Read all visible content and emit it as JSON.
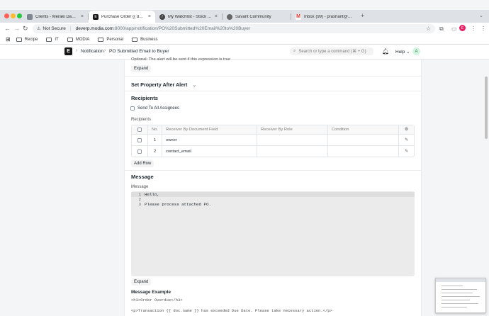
{
  "browser": {
    "tabs": [
      {
        "title": "Clients - Meraki Dashboard",
        "fav_color": "#7e8792",
        "active": false
      },
      {
        "title": "Purchase Order {{ doc.name }}",
        "fav_color": "#171717",
        "active": true
      },
      {
        "title": "My Watchlist - Stock Portfolio",
        "fav_color": "#444444",
        "active": false
      },
      {
        "title": "Savant Community",
        "fav_color": "#666666",
        "active": false
      },
      {
        "title": "Inbox (99) - prashant@modia",
        "fav_color": "#d93025",
        "active": false
      }
    ],
    "security_label": "Not Secure",
    "url_host": "deverp.modia.com",
    "url_path": ":8000/app/notification/PO%20Submitted%20Email%20to%20Buyer",
    "profile_initial": "E"
  },
  "bookmarks": [
    {
      "label": "Recipe"
    },
    {
      "label": "IT"
    },
    {
      "label": "MODIA"
    },
    {
      "label": "Personal"
    },
    {
      "label": "Business"
    }
  ],
  "navbar": {
    "logo_letter": "E",
    "breadcrumb_module": "Notification",
    "breadcrumb_doc": "PO Submitted Email to Buyer",
    "search_placeholder": "Search or type a command (⌘ + G)",
    "help_label": "Help",
    "user_initial": "A"
  },
  "form": {
    "condition_help": "Optional: The alert will be sent if this expression is true",
    "expand_label_1": "Expand",
    "set_property_title": "Set Property After Alert",
    "recipients_title": "Recipients",
    "send_to_all_label": "Send To All Assignees",
    "recipients_table_label": "Recipients",
    "table_headers": {
      "no": "No.",
      "field": "Receiver By Document Field",
      "role": "Receiver By Role",
      "condition": "Condition"
    },
    "rows": [
      {
        "no": "1",
        "field": "owner",
        "role": "",
        "condition": ""
      },
      {
        "no": "2",
        "field": "contact_email",
        "role": "",
        "condition": ""
      }
    ],
    "add_row_label": "Add Row",
    "message_title": "Message",
    "message_label": "Message",
    "message_lines": [
      {
        "no": "1",
        "text": "Hello,"
      },
      {
        "no": "2",
        "text": ""
      },
      {
        "no": "3",
        "text": "Please process attached PO."
      }
    ],
    "expand_label_2": "Expand",
    "message_example_title": "Message Example",
    "example_line_1": "<h3>Order Overdue</h3>",
    "example_line_2": "<p>Transaction {{ doc.name }} has exceeded Due Date. Please take necessary action.</p>"
  }
}
